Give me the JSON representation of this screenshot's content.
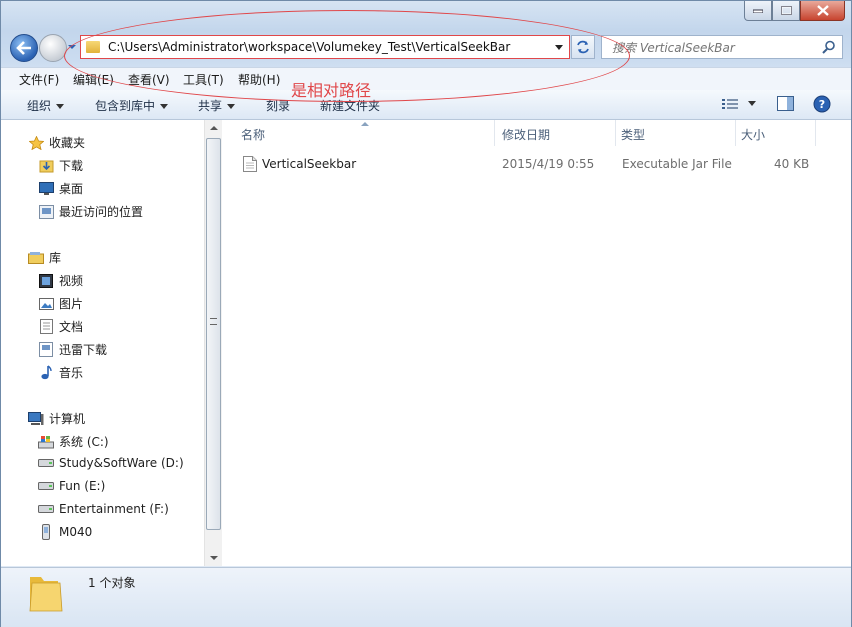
{
  "window": {
    "caption_buttons": [
      "minimize",
      "maximize",
      "close"
    ]
  },
  "address": {
    "path": "C:\\Users\\Administrator\\workspace\\Volumekey_Test\\VerticalSeekBar"
  },
  "search": {
    "placeholder": "搜索 VerticalSeekBar"
  },
  "menu": {
    "file": "文件(F)",
    "edit": "编辑(E)",
    "view": "查看(V)",
    "tools": "工具(T)",
    "help": "帮助(H)"
  },
  "annotation": {
    "text": "是相对路径",
    "color": "#e0474a"
  },
  "toolbar": {
    "organize": "组织",
    "include_in_library": "包含到库中",
    "share": "共享",
    "burn": "刻录",
    "new_folder": "新建文件夹"
  },
  "sidebar": {
    "favorites": {
      "label": "收藏夹",
      "items": [
        {
          "label": "下载",
          "icon": "download-folder-icon"
        },
        {
          "label": "桌面",
          "icon": "desktop-icon"
        },
        {
          "label": "最近访问的位置",
          "icon": "recent-places-icon"
        }
      ]
    },
    "libraries": {
      "label": "库",
      "items": [
        {
          "label": "视频",
          "icon": "video-library-icon"
        },
        {
          "label": "图片",
          "icon": "picture-library-icon"
        },
        {
          "label": "文档",
          "icon": "document-library-icon"
        },
        {
          "label": "迅雷下载",
          "icon": "thunder-download-icon"
        },
        {
          "label": "音乐",
          "icon": "music-library-icon"
        }
      ]
    },
    "computer": {
      "label": "计算机",
      "items": [
        {
          "label": "系统 (C:)",
          "icon": "system-drive-icon"
        },
        {
          "label": "Study&SoftWare (D:)",
          "icon": "drive-icon"
        },
        {
          "label": "Fun (E:)",
          "icon": "drive-icon"
        },
        {
          "label": "Entertainment (F:)",
          "icon": "drive-icon"
        },
        {
          "label": "M040",
          "icon": "phone-device-icon"
        }
      ]
    }
  },
  "columns": {
    "name": "名称",
    "modified": "修改日期",
    "type": "类型",
    "size": "大小"
  },
  "files": [
    {
      "name": "VerticalSeekbar",
      "modified": "2015/4/19 0:55",
      "type": "Executable Jar File",
      "size": "40 KB"
    }
  ],
  "status": {
    "count": "1 个对象"
  },
  "colors": {
    "accent": "#2b62b3",
    "annotation": "#e0474a"
  }
}
